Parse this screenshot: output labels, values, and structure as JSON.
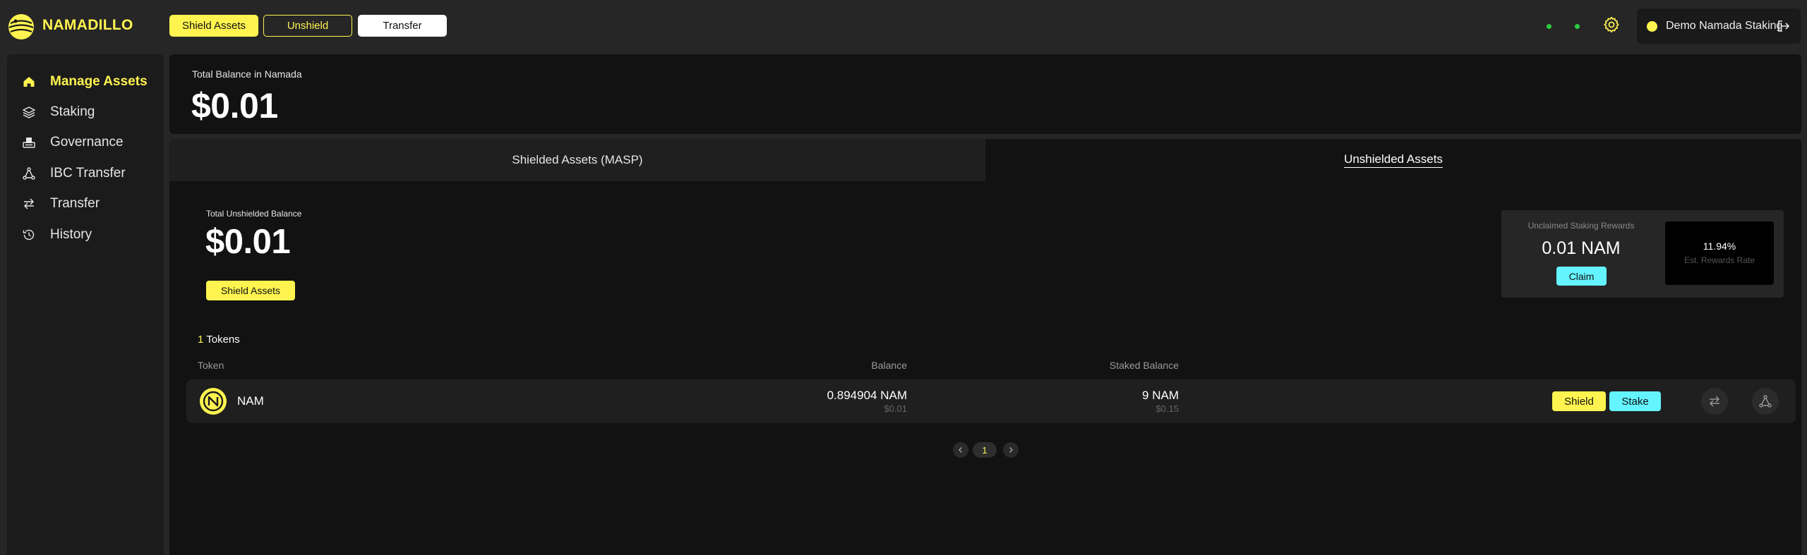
{
  "app": {
    "brand": "NAMADILLO"
  },
  "topbar": {
    "shield_label": "Shield Assets",
    "unshield_label": "Unshield",
    "transfer_label": "Transfer",
    "account_name": "Demo Namada Staking",
    "status_color": "#2ecc40",
    "accent_color": "#fff44f"
  },
  "sidebar": {
    "items": [
      {
        "label": "Manage Assets",
        "icon": "home-icon",
        "active": true
      },
      {
        "label": "Staking",
        "icon": "layers-icon",
        "active": false
      },
      {
        "label": "Governance",
        "icon": "governance-icon",
        "active": false
      },
      {
        "label": "IBC Transfer",
        "icon": "ibc-icon",
        "active": false
      },
      {
        "label": "Transfer",
        "icon": "transfer-icon",
        "active": false
      },
      {
        "label": "History",
        "icon": "history-icon",
        "active": false
      }
    ]
  },
  "balance": {
    "label": "Total Balance in Namada",
    "value": "$0.01"
  },
  "tabs": {
    "shielded": "Shielded Assets (MASP)",
    "unshielded": "Unshielded Assets",
    "active": "unshielded"
  },
  "unshielded": {
    "label": "Total Unshielded Balance",
    "value": "$0.01",
    "shield_button": "Shield Assets"
  },
  "rewards": {
    "label": "Unclaimed Staking Rewards",
    "value": "0.01 NAM",
    "claim_label": "Claim",
    "rate_value": "11.94%",
    "rate_label": "Est. Rewards Rate"
  },
  "tokens": {
    "count": "1",
    "count_label": "Tokens",
    "headers": {
      "token": "Token",
      "balance": "Balance",
      "staked": "Staked Balance"
    },
    "rows": [
      {
        "name": "NAM",
        "balance": "0.894904 NAM",
        "balance_usd": "$0.01",
        "staked": "9 NAM",
        "staked_usd": "$0.15",
        "shield_label": "Shield",
        "stake_label": "Stake"
      }
    ]
  },
  "pagination": {
    "current_page": "1"
  }
}
